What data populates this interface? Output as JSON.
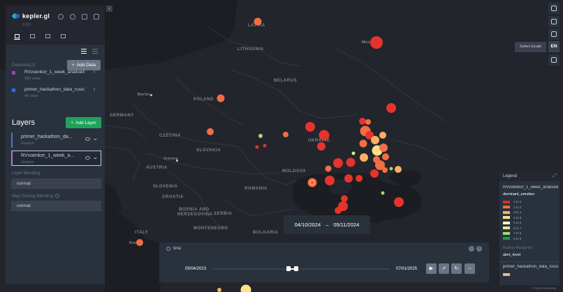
{
  "app": {
    "name": "kepler.gl",
    "version": "3.0.0"
  },
  "header_icons": [
    "bug-icon",
    "info-icon",
    "database-icon",
    "share-icon"
  ],
  "panel_tabs": [
    "layers-tab-icon",
    "filter-tab-icon",
    "interaction-tab-icon",
    "basemap-tab-icon"
  ],
  "datasets": {
    "title": "Datasets(2)",
    "add_label": "Add Data",
    "items": [
      {
        "name": "RVvoenkor_1_week_analised",
        "rows": "350 rows",
        "color": "#a33fb7"
      },
      {
        "name": "primer_hackathon_data_russi",
        "rows": "45 rows",
        "color": "#2b6fe0"
      }
    ]
  },
  "layers": {
    "title": "Layers",
    "add_label": "Add Layer",
    "items": [
      {
        "name": "primer_hackathon_da...",
        "type": "Geojson",
        "selected": false
      },
      {
        "name": "RVvoenkor_1_week_a...",
        "type": "Geojson",
        "selected": true
      }
    ],
    "blending_label": "Layer Blending",
    "blending_value": "normal",
    "overlay_label": "Map Overlay Blending",
    "overlay_value": "normal"
  },
  "map_controls": {
    "locale_tooltip": "Select locale",
    "locale": "EN"
  },
  "map_labels": {
    "countries": [
      "LATVIA",
      "LITHUANIA",
      "BELARUS",
      "POLAND",
      "GERMANY",
      "CZECHIA",
      "SLOVAKIA",
      "AUSTRIA",
      "UKRAINE",
      "MOLDOVA",
      "ROMANIA",
      "SLOVENIA",
      "CROATIA",
      "BOSNIA AND HERZEGOVINA",
      "SERBIA",
      "MONTENEGRO",
      "BULGARIA",
      "ITALY"
    ],
    "cities": [
      "Moscow",
      "Berlin",
      "Vienna",
      "Rome"
    ]
  },
  "legend": {
    "title": "Legend",
    "layer_name": "RVvoenkor_1_week_analised",
    "color_field": "dominant_emotion",
    "items": [
      {
        "label": "1 to 2",
        "color": "#d73027"
      },
      {
        "label": "2 to 3",
        "color": "#f46d43"
      },
      {
        "label": "3 to 4",
        "color": "#fdae61"
      },
      {
        "label": "4 to 5",
        "color": "#fee08b"
      },
      {
        "label": "5 to 6",
        "color": "#ffffbf"
      },
      {
        "label": "6 to 7",
        "color": "#d9ef8b"
      },
      {
        "label": "7 to 8",
        "color": "#a6d96a"
      },
      {
        "label": "8 to 9",
        "color": "#1a9850"
      }
    ],
    "radius_label": "Radius Range by",
    "radius_field": "alert_level",
    "layer2_name": "primer_hackathon_data_russi",
    "layer2_color": "#f0b87b"
  },
  "time": {
    "range_start": "04/10/2024",
    "range_sep": "–",
    "range_end": "05/11/2024",
    "field": "time",
    "domain_start": "05/04/2023",
    "domain_end": "07/01/2025",
    "selected_fraction": [
      0.43,
      0.47
    ]
  },
  "attribution": "© OpenStreetMap"
}
